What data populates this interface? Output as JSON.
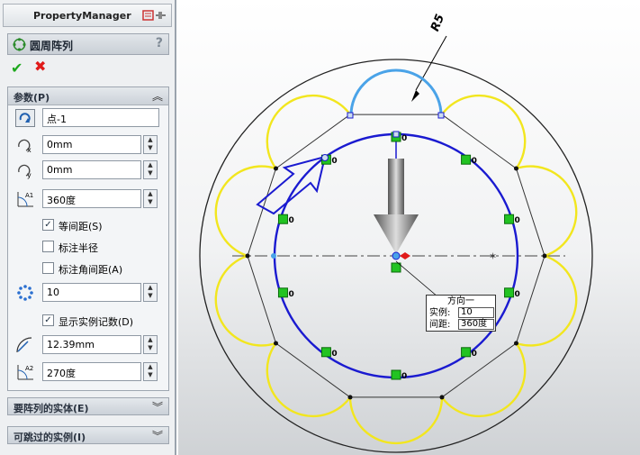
{
  "pm": {
    "title": "PropertyManager",
    "feature_name": "圆周阵列",
    "help": "?",
    "ok": "✔",
    "cancel": "✖",
    "params": {
      "title": "参数(P)",
      "toggle": "︽",
      "center": "点-1",
      "x": "0mm",
      "y": "0mm",
      "angle": "360度",
      "equal_spacing": "等间距(S)",
      "equal_spacing_checked": true,
      "dim_radius": "标注半径",
      "dim_radius_checked": false,
      "dim_angle": "标注角间距(A)",
      "dim_angle_checked": false,
      "count": "10",
      "show_count": "显示实例记数(D)",
      "show_count_checked": true,
      "radius": "12.39mm",
      "arc_angle": "270度"
    },
    "entities": {
      "title": "要阵列的实体(E)",
      "toggle": "︾"
    },
    "skip": {
      "title": "可跳过的实例(I)",
      "toggle": "︾"
    }
  },
  "viewport": {
    "dimension": "R5",
    "instance_label": "0",
    "callout": {
      "title": "方向一",
      "count_label": "实例:",
      "count_value": "10",
      "spacing_label": "间距:",
      "spacing_value": "360度"
    },
    "colors": {
      "yellow": "#f2e61e",
      "blue": "#1a1ad0",
      "light_blue": "#4aa3e8",
      "green": "#22c322"
    }
  }
}
